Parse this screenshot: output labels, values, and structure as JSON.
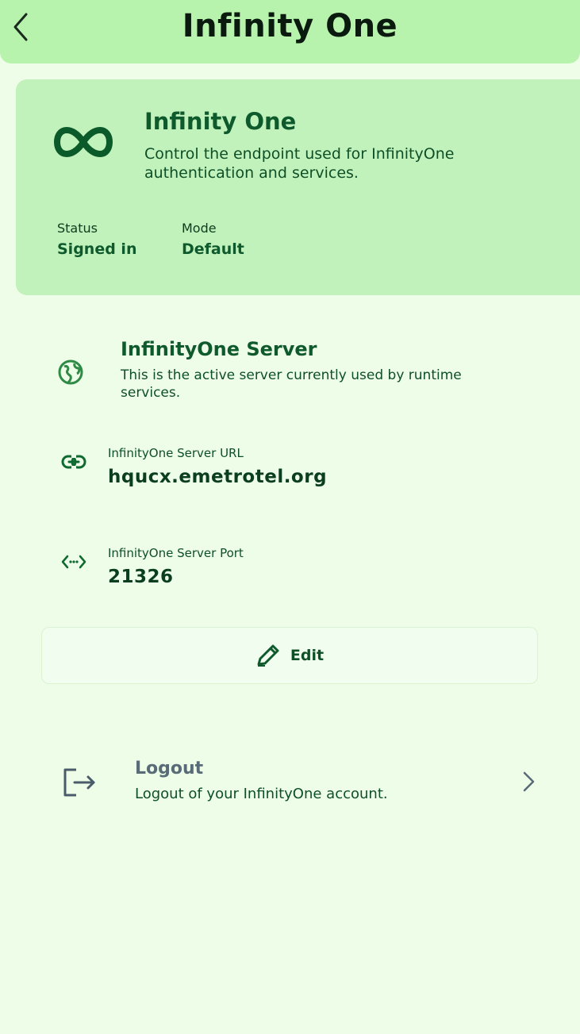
{
  "header": {
    "title": "Infinity One",
    "back_icon": "chevron-left-icon"
  },
  "hero": {
    "icon": "infinity-icon",
    "title": "Infinity One",
    "description": "Control the endpoint used for InfinityOne authentication and services.",
    "status_label": "Status",
    "status_value": "Signed in",
    "mode_label": "Mode",
    "mode_value": "Default"
  },
  "server": {
    "icon": "globe-icon",
    "title": "InfinityOne Server",
    "description": "This is the active server currently used by runtime services."
  },
  "fields": {
    "url": {
      "icon": "link-icon",
      "label": "InfinityOne Server URL",
      "value": "hqucx.emetrotel.org"
    },
    "port": {
      "icon": "code-arrows-icon",
      "label": "InfinityOne Server Port",
      "value": "21326"
    }
  },
  "actions": {
    "edit_label": "Edit",
    "edit_icon": "pencil-icon"
  },
  "logout": {
    "icon": "logout-icon",
    "title": "Logout",
    "description": "Logout of your InfinityOne account.",
    "chevron_icon": "chevron-right-icon"
  },
  "colors": {
    "topbar_bg": "#b8f3ae",
    "hero_bg": "#c2f2bb",
    "page_bg": "#eefde8",
    "accent_green": "#0e5a2c",
    "logout_gray": "#5a6b78"
  }
}
